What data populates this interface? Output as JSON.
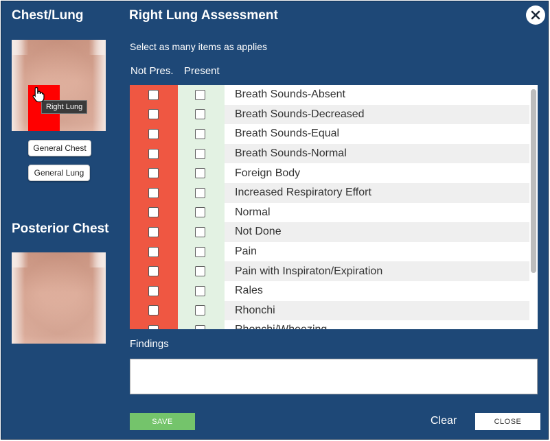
{
  "sidebar": {
    "front_title": "Chest/Lung",
    "tooltip": "Right Lung",
    "general_chest": "General Chest",
    "general_lung": "General Lung",
    "posterior_title": "Posterior Chest"
  },
  "header": {
    "title": "Right Lung Assessment"
  },
  "instruction": "Select as many items as applies",
  "columns": {
    "not_present": "Not Pres.",
    "present": "Present"
  },
  "items": [
    "Breath Sounds-Absent",
    "Breath Sounds-Decreased",
    "Breath Sounds-Equal",
    "Breath Sounds-Normal",
    "Foreign Body",
    "Increased Respiratory Effort",
    "Normal",
    "Not Done",
    "Pain",
    "Pain with Inspiraton/Expiration",
    "Rales",
    "Rhonchi",
    "Rhonchi/Wheezing"
  ],
  "findings": {
    "label": "Findings",
    "value": ""
  },
  "footer": {
    "save": "SAVE",
    "clear": "Clear",
    "close": "CLOSE"
  },
  "colors": {
    "background": "#1e4877",
    "not_present_column": "#ef5742",
    "present_column": "#e3f2e3",
    "save_button": "#74c46b"
  },
  "icons": {
    "close": "close-x-icon",
    "cursor": "hand-pointer-icon"
  }
}
